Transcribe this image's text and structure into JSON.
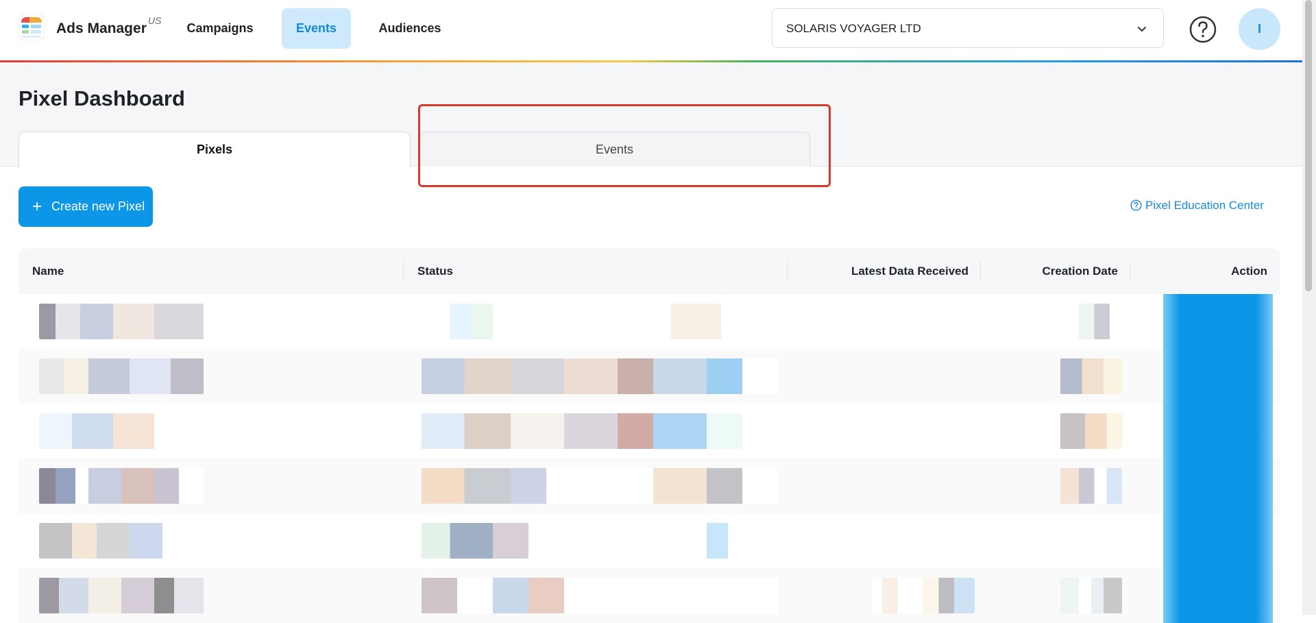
{
  "header": {
    "brand": "Ads Manager",
    "region": "US",
    "nav": [
      {
        "label": "Campaigns"
      },
      {
        "label": "Events",
        "active": true
      },
      {
        "label": "Audiences"
      }
    ],
    "account": "SOLARIS VOYAGER LTD",
    "avatar_initial": "I"
  },
  "page": {
    "title": "Pixel Dashboard",
    "tabs": [
      {
        "label": "Pixels",
        "active": true
      },
      {
        "label": "Events"
      }
    ]
  },
  "actions": {
    "create_button": "Create new Pixel",
    "education_link": "Pixel Education Center"
  },
  "table": {
    "columns": [
      "Name",
      "Status",
      "Latest Data Received",
      "Creation Date",
      "Action"
    ],
    "rows_visible": 6
  },
  "colors": {
    "accent": "#0b96e8",
    "nav_active_bg": "#cde9fb",
    "highlight": "#d63a2b"
  },
  "icons": {
    "logo": "ads-manager-logo",
    "chevron": "chevron-down-icon",
    "help": "help-circle-icon",
    "plus": "plus-icon",
    "education": "question-circle-icon"
  }
}
